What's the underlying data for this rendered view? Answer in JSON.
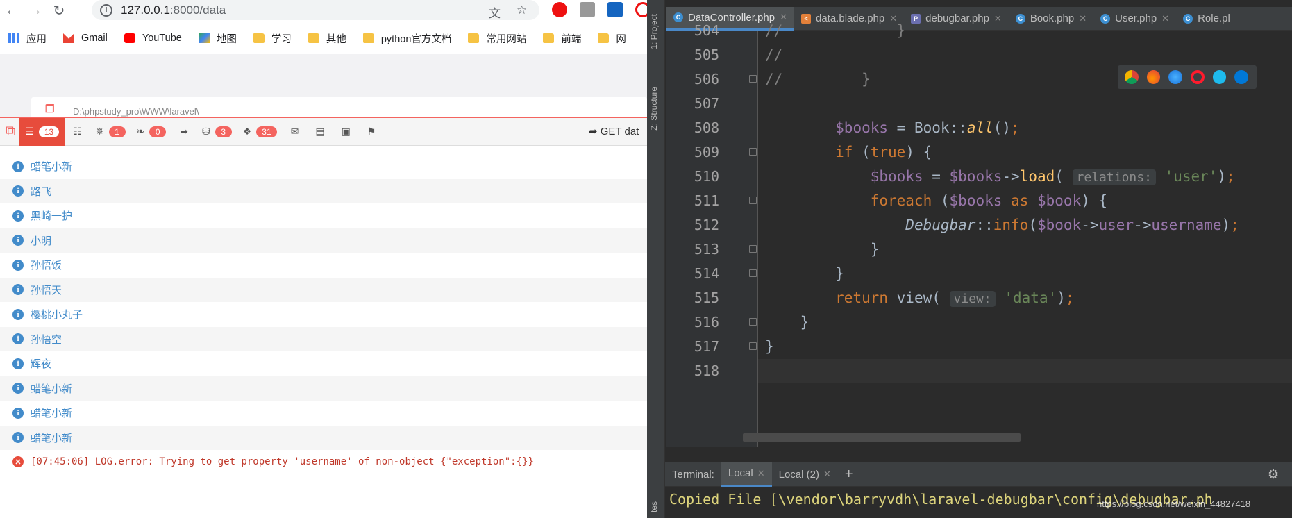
{
  "browser": {
    "url_host": "127.0.0.1",
    "url_path": ":8000/data",
    "bookmarks": [
      {
        "label": "应用",
        "icon": "apps-icon"
      },
      {
        "label": "Gmail",
        "icon": "gmail-icon"
      },
      {
        "label": "YouTube",
        "icon": "youtube-icon"
      },
      {
        "label": "地图",
        "icon": "maps-icon"
      },
      {
        "label": "学习",
        "icon": "folder-icon"
      },
      {
        "label": "其他",
        "icon": "folder-icon"
      },
      {
        "label": "python官方文档",
        "icon": "folder-icon"
      },
      {
        "label": "常用网站",
        "icon": "folder-icon"
      },
      {
        "label": "前端",
        "icon": "folder-icon"
      },
      {
        "label": "网",
        "icon": "folder-icon"
      }
    ],
    "page_path": "D:\\phpstudy_pro\\WWW\\laravel\\",
    "debugbar": {
      "tabs": [
        {
          "name": "messages",
          "icon": "messages-icon",
          "count": "13"
        },
        {
          "name": "timeline",
          "icon": "timeline-icon",
          "count": ""
        },
        {
          "name": "exceptions",
          "icon": "bug-icon",
          "count": "1"
        },
        {
          "name": "views",
          "icon": "leaf-icon",
          "count": "0"
        },
        {
          "name": "route",
          "icon": "share-icon",
          "count": ""
        },
        {
          "name": "queries",
          "icon": "database-icon",
          "count": "3"
        },
        {
          "name": "models",
          "icon": "cubes-icon",
          "count": "31"
        },
        {
          "name": "mails",
          "icon": "inbox-icon",
          "count": ""
        },
        {
          "name": "request",
          "icon": "tags-icon",
          "count": ""
        }
      ],
      "request_label": "GET dat"
    },
    "messages": [
      "蜡笔小新",
      "路飞",
      "黑崎一护",
      "小明",
      "孙悟饭",
      "孙悟天",
      "樱桃小丸子",
      "孙悟空",
      "辉夜",
      "蜡笔小新",
      "蜡笔小新",
      "蜡笔小新"
    ],
    "error": "[07:45:06] LOG.error: Trying to get property 'username' of non-object {\"exception\":{}}"
  },
  "ide": {
    "sidebar": {
      "project": "1: Project",
      "structure": "Z: Structure",
      "bottom": "tes"
    },
    "tabs": [
      {
        "label": "DataController.php",
        "icon": "class-icon",
        "active": true
      },
      {
        "label": "data.blade.php",
        "icon": "html-icon",
        "active": false
      },
      {
        "label": "debugbar.php",
        "icon": "php-icon",
        "active": false
      },
      {
        "label": "Book.php",
        "icon": "class-icon",
        "active": false
      },
      {
        "label": "User.php",
        "icon": "class-icon",
        "active": false
      },
      {
        "label": "Role.pl",
        "icon": "class-icon",
        "active": false
      }
    ],
    "line_numbers": [
      "504",
      "505",
      "506",
      "507",
      "508",
      "509",
      "510",
      "511",
      "512",
      "513",
      "514",
      "515",
      "516",
      "517",
      "518"
    ],
    "code_lines": [
      "//             }",
      "//",
      "//         }",
      "",
      "        $books = Book::all();",
      "        if (true) {",
      "            $books = $books->load( relations: 'user');",
      "            foreach ($books as $book) {",
      "                Debugbar::info($book->user->username);",
      "            }",
      "        }",
      "        return view( view: 'data');",
      "    }",
      "}",
      ""
    ],
    "terminal": {
      "label": "Terminal:",
      "tabs": [
        "Local",
        "Local (2)"
      ],
      "add": "+",
      "output": "Copied File [\\vendor\\barryvdh\\laravel-debugbar\\config\\debugbar.ph"
    },
    "watermark": "https://blog.csdn.net/weixin_44827418"
  }
}
